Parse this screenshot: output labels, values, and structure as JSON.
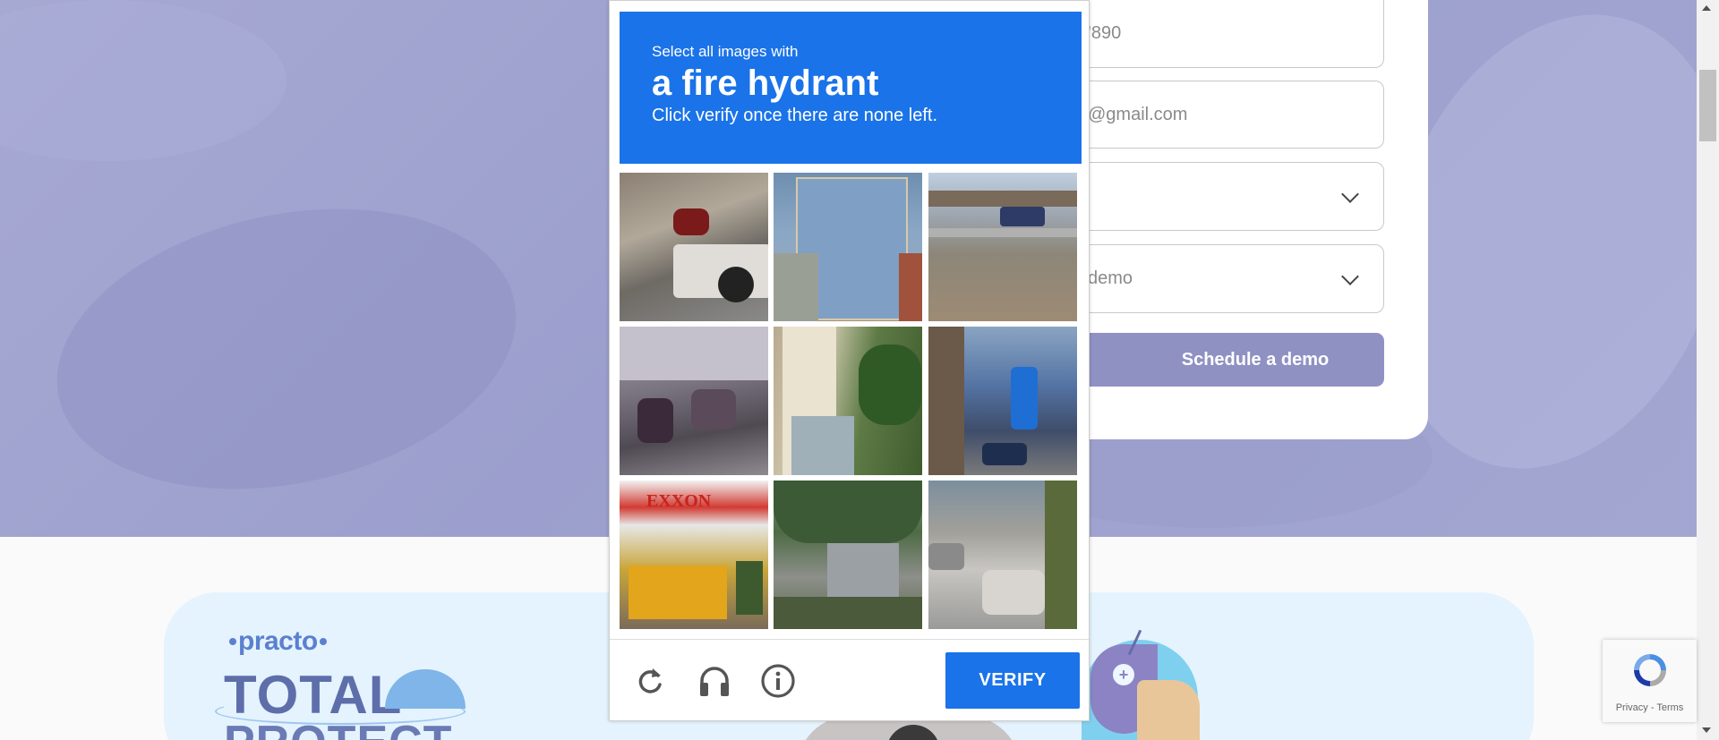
{
  "form": {
    "phone_value": "'890",
    "email_value": "@gmail.com",
    "select_one_value": "",
    "select_two_value": "demo",
    "schedule_label": "Schedule a demo"
  },
  "captcha": {
    "select_text": "Select all images with",
    "target": "a fire hydrant",
    "instruction": "Click verify once there are none left.",
    "tiles": [
      {
        "subject": "truck-and-motorcycle-street"
      },
      {
        "subject": "garage-door-utility-box"
      },
      {
        "subject": "overpass-road"
      },
      {
        "subject": "sidewalk-bikes"
      },
      {
        "subject": "porch-steps-plant"
      },
      {
        "subject": "blue-pole-street"
      },
      {
        "subject": "gas-station-school-bus"
      },
      {
        "subject": "trees-street"
      },
      {
        "subject": "street-cars"
      }
    ],
    "icons": [
      "reload-icon",
      "audio-icon",
      "info-icon"
    ],
    "verify_label": "VERIFY",
    "accent_color": "#1a73e8"
  },
  "promo": {
    "brand": "practo",
    "product_line1": "TOTAL",
    "product_line2": "PROTECT"
  },
  "recaptcha_badge": {
    "privacy_label": "Privacy",
    "separator": " - ",
    "terms_label": "Terms"
  },
  "colors": {
    "hero_bg": "#a1a4cf",
    "schedule_button": "#8f91c3"
  }
}
